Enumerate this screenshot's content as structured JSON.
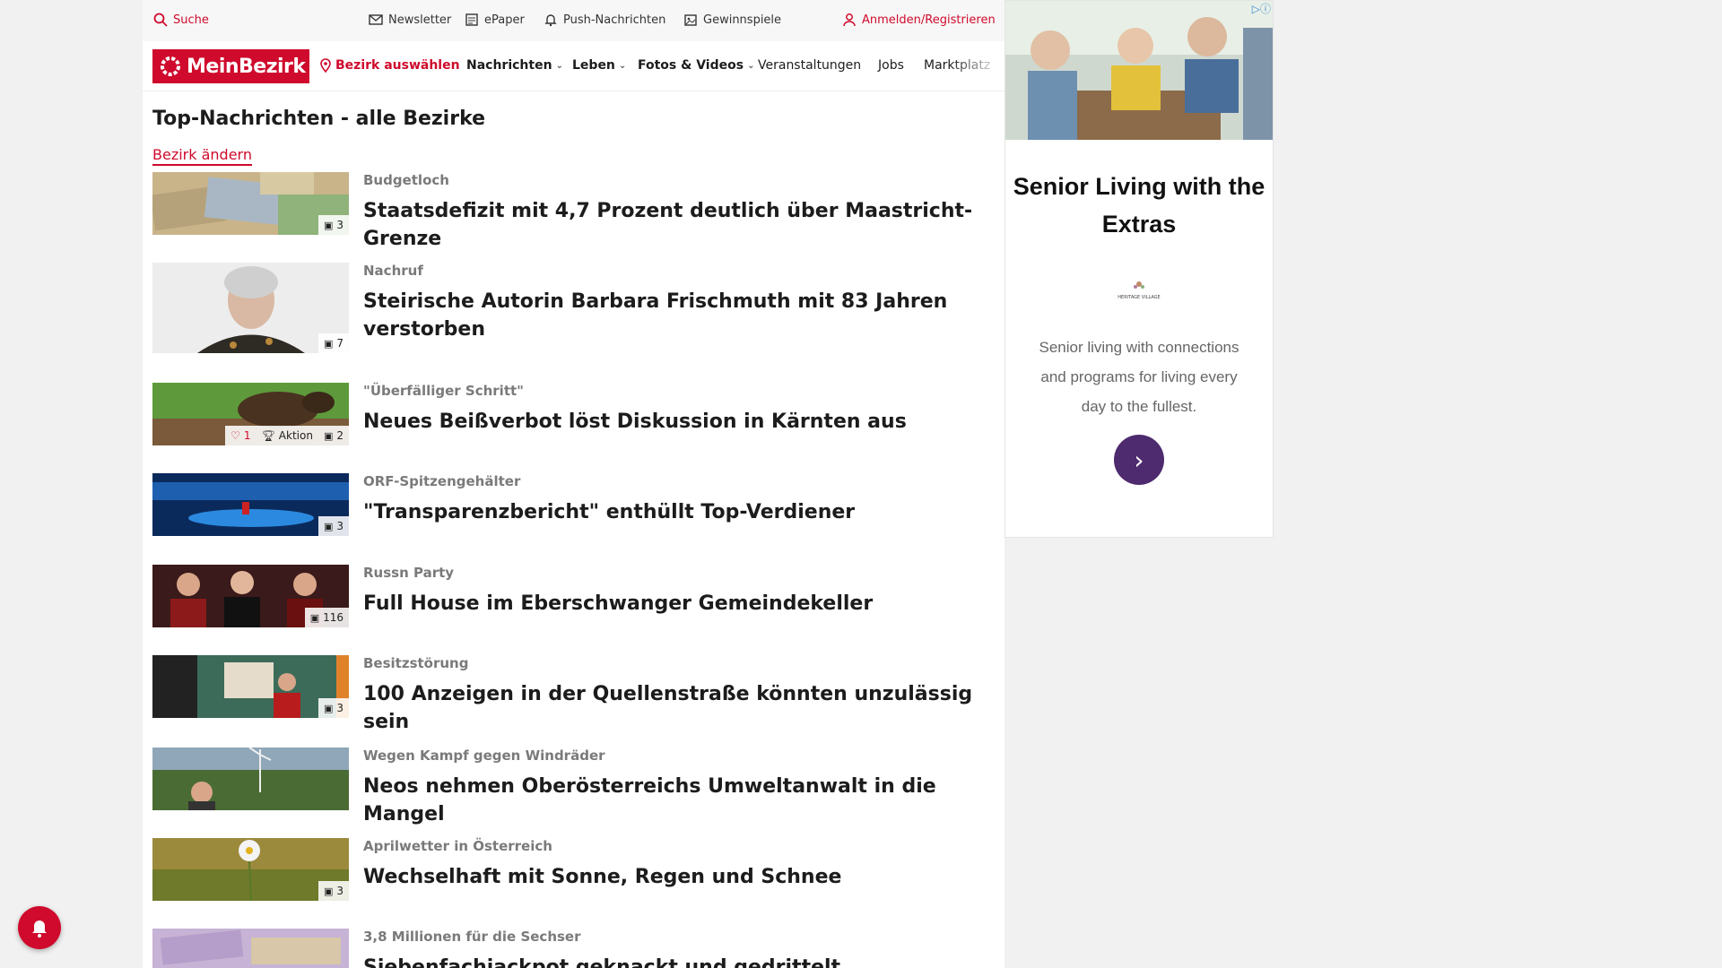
{
  "topbar": {
    "search": "Suche",
    "newsletter": "Newsletter",
    "epaper": "ePaper",
    "push": "Push-Nachrichten",
    "gewinnspiele": "Gewinnspiele",
    "login": "Anmelden/Registrieren"
  },
  "logo": {
    "text": "MeinBezirk"
  },
  "nav": {
    "district": "Bezirk auswählen",
    "items": [
      "Nachrichten",
      "Leben",
      "Fotos & Videos",
      "Veranstaltungen",
      "Jobs",
      "Marktplatz"
    ]
  },
  "main": {
    "title": "Top-Nachrichten - alle Bezirke",
    "change_district": "Bezirk ändern",
    "articles": [
      {
        "kicker": "Budgetloch",
        "headline": "Staatsdefizit mit 4,7 Prozent deutlich über Maastricht-Grenze",
        "photos": "3"
      },
      {
        "kicker": "Nachruf",
        "headline": "Steirische Autorin Barbara Frischmuth mit 83 Jahren verstorben",
        "photos": "7"
      },
      {
        "kicker": "\"Überfälliger Schritt\"",
        "headline": "Neues Beißverbot löst Diskussion in Kärnten aus",
        "photos": "2",
        "likes": "1",
        "aktion": "Aktion"
      },
      {
        "kicker": "ORF-Spitzengehälter",
        "headline": "\"Transparenzbericht\" enthüllt Top-Verdiener",
        "photos": "3"
      },
      {
        "kicker": "Russn Party",
        "headline": "Full House im Eberschwanger Gemeindekeller",
        "photos": "116"
      },
      {
        "kicker": "Besitzstörung",
        "headline": "100 Anzeigen in der Quellenstraße könnten unzulässig sein",
        "photos": "3"
      },
      {
        "kicker": "Wegen Kampf gegen Windräder",
        "headline": "Neos nehmen Oberösterreichs Umweltanwalt in die Mangel",
        "photos": ""
      },
      {
        "kicker": "Aprilwetter in Österreich",
        "headline": "Wechselhaft mit Sonne, Regen und Schnee",
        "photos": "3"
      },
      {
        "kicker": "3,8 Millionen für die Sechser",
        "headline": "Siebenfachjackpot geknackt und gedrittelt",
        "photos": ""
      }
    ]
  },
  "ad": {
    "title": "Senior Living with the Extras",
    "body": "Senior living with connections and programs for living every day to the fullest.",
    "logo_text": "HERITAGE VILLAGE"
  },
  "colors": {
    "brand": "#cf0a2c",
    "ad_button": "#4e2a6e"
  }
}
